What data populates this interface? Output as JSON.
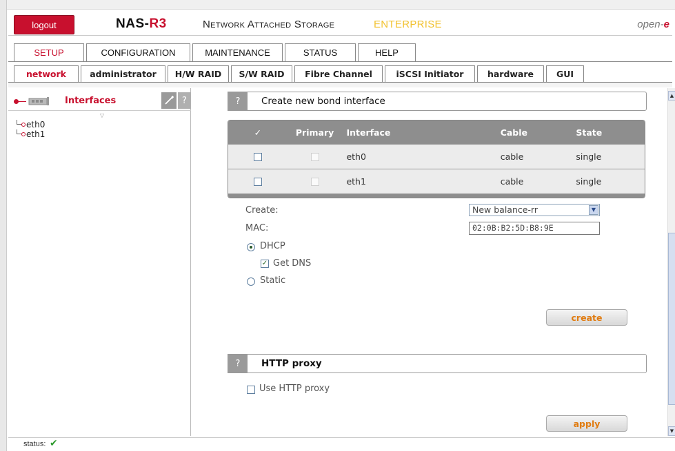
{
  "header": {
    "logout_label": "logout",
    "brand_prefix": "NAS-",
    "brand_suffix": "R3",
    "subtitle": "Network Attached Storage",
    "edition": "ENTERPRISE",
    "vendor_prefix": "open-",
    "vendor_suffix": "e"
  },
  "main_tabs": [
    {
      "label": "SETUP",
      "active": true
    },
    {
      "label": "CONFIGURATION"
    },
    {
      "label": "MAINTENANCE"
    },
    {
      "label": "STATUS"
    },
    {
      "label": "HELP"
    }
  ],
  "sub_tabs": [
    {
      "label": "network",
      "active": true
    },
    {
      "label": "administrator"
    },
    {
      "label": "H/W RAID"
    },
    {
      "label": "S/W RAID"
    },
    {
      "label": "Fibre Channel"
    },
    {
      "label": "iSCSI Initiator"
    },
    {
      "label": "hardware"
    },
    {
      "label": "GUI"
    }
  ],
  "left_panel": {
    "title": "Interfaces",
    "help_label": "?",
    "tree": [
      "eth0",
      "eth1"
    ]
  },
  "bond_section": {
    "help_label": "?",
    "title": "Create new bond interface",
    "table": {
      "headers": {
        "check": "✓",
        "primary": "Primary",
        "interface": "Interface",
        "cable": "Cable",
        "state": "State"
      },
      "rows": [
        {
          "interface": "eth0",
          "cable": "cable",
          "state": "single"
        },
        {
          "interface": "eth1",
          "cable": "cable",
          "state": "single"
        }
      ]
    },
    "form": {
      "create_label": "Create:",
      "create_value": "New balance-rr",
      "mac_label": "MAC:",
      "mac_value": "02:0B:B2:5D:B8:9E",
      "dhcp_label": "DHCP",
      "dhcp_selected": true,
      "get_dns_label": "Get DNS",
      "get_dns_checked": true,
      "static_label": "Static"
    },
    "create_button": "create"
  },
  "proxy_section": {
    "help_label": "?",
    "title": "HTTP proxy",
    "use_proxy_label": "Use HTTP proxy",
    "use_proxy_checked": false,
    "apply_button": "apply"
  },
  "status": {
    "label": "status:",
    "icon": "check-icon"
  },
  "colors": {
    "brand_red": "#c8102e",
    "edition_yellow": "#f2c230",
    "button_text": "#e07b10",
    "table_header": "#8e8e8e"
  }
}
